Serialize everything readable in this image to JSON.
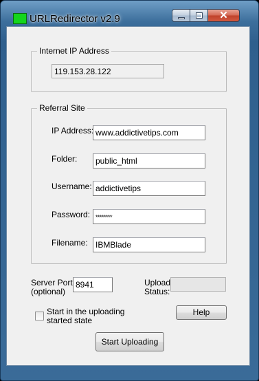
{
  "window": {
    "title": "URLRedirector v2.9",
    "close_glyph": "✕"
  },
  "internet_ip": {
    "group_title": "Internet IP Address",
    "value": "119.153.28.122"
  },
  "referral": {
    "group_title": "Referral Site",
    "ip_label": "IP Address:",
    "ip_value": "www.addictivetips.com",
    "folder_label": "Folder:",
    "folder_value": "public_html",
    "username_label": "Username:",
    "username_value": "addictivetips",
    "password_label": "Password:",
    "password_value": "********",
    "filename_label": "Filename:",
    "filename_value": "IBMBlade"
  },
  "server_port": {
    "label_line1": "Server Port:",
    "label_line2": "(optional)",
    "value": "8941"
  },
  "upload_status": {
    "label_line1": "Upload",
    "label_line2": "Status:",
    "value": ""
  },
  "start_state": {
    "label_line1": "Start in the uploading",
    "label_line2": "started state",
    "checked": false
  },
  "buttons": {
    "help": "Help",
    "start_uploading": "Start Uploading"
  },
  "colors": {
    "app_icon": "#14d51c",
    "close_button": "#c0422b"
  }
}
